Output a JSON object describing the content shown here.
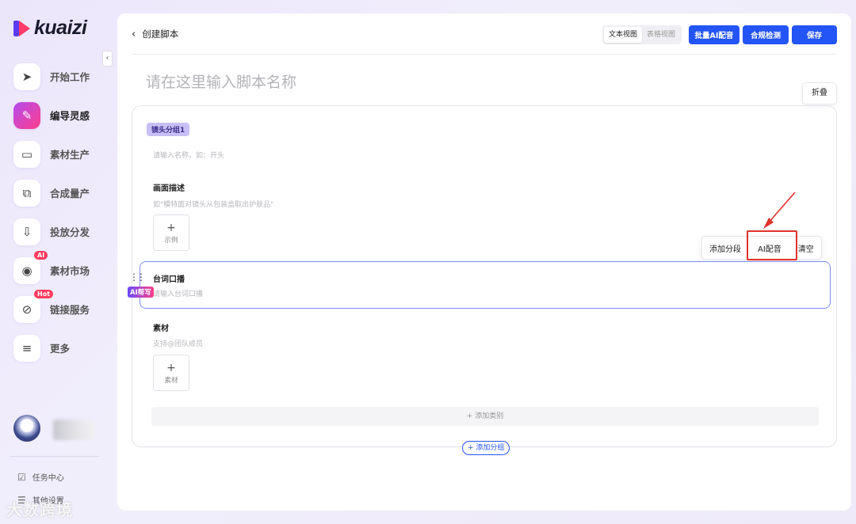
{
  "brand": {
    "logo_text": "kuaizi"
  },
  "sidebar": {
    "collapse_icon": "‹",
    "items": [
      {
        "label": "开始工作",
        "icon": "➤",
        "active": false
      },
      {
        "label": "编导灵感",
        "icon": "✎",
        "active": true
      },
      {
        "label": "素材生产",
        "icon": "▭",
        "active": false
      },
      {
        "label": "合成量产",
        "icon": "⧉",
        "active": false
      },
      {
        "label": "投放分发",
        "icon": "⇩",
        "active": false
      },
      {
        "label": "素材市场",
        "icon": "◉",
        "active": false,
        "badge": "AI"
      },
      {
        "label": "链接服务",
        "icon": "⊘",
        "active": false,
        "badge": "Hot"
      },
      {
        "label": "更多",
        "icon": "≡",
        "active": false
      }
    ],
    "task_center": "任务中心",
    "other_settings": "其他设置"
  },
  "topbar": {
    "back_label": "创建脚本",
    "view_text": "文本视图",
    "view_table": "表格视图",
    "batch_ai_dub": "批量AI配音",
    "compliance_check": "合规检测",
    "save": "保存"
  },
  "editor": {
    "title_placeholder": "请在这里输入脚本名称",
    "fold_button": "折叠",
    "group_tag": "镜头分组1",
    "group_name_placeholder": "请输入名称，如：开头",
    "scene_label": "画面描述",
    "scene_placeholder": "如\"模特面对镜头从包装盒取出护肤品\"",
    "example_button": "示例",
    "dialogue_label": "台词口播",
    "dialogue_placeholder": "请输入台词口播",
    "ai_rewrite": "AI帮写",
    "toolbar": {
      "add_segment": "添加分段",
      "ai_dub": "AI配音",
      "clear": "清空"
    },
    "material_label": "素材",
    "material_placeholder": "支持@团队成员",
    "material_button": "素材",
    "add_category": "+ 添加类别",
    "add_group": "+ 添加分组"
  },
  "watermark": "大数跨境",
  "colors": {
    "primary": "#2354f5",
    "accent_gradient_start": "#b34cf0",
    "accent_gradient_end": "#ff3e8a",
    "highlight": "#e0322b"
  }
}
